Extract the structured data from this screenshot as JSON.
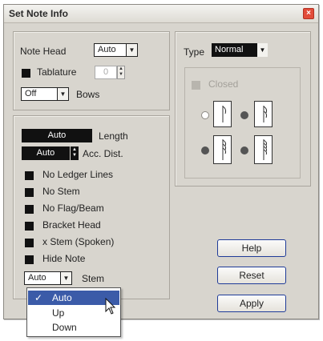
{
  "window": {
    "title": "Set Note Info",
    "close_glyph": "×"
  },
  "notehead": {
    "label": "Note Head",
    "value": "Auto",
    "tablature_label": "Tablature",
    "tablature_value": "0",
    "bows_value": "Off",
    "bows_label": "Bows"
  },
  "left": {
    "length_value": "Auto",
    "length_label": "Length",
    "acc_value": "Auto",
    "acc_label": "Acc. Dist.",
    "options": [
      "No Ledger Lines",
      "No Stem",
      "No Flag/Beam",
      "Bracket Head",
      "x Stem (Spoken)",
      "Hide Note"
    ],
    "stem_value": "Auto",
    "stem_label": "Stem"
  },
  "type": {
    "label": "Type",
    "value": "Normal",
    "closed_label": "Closed"
  },
  "buttons": {
    "help": "Help",
    "reset": "Reset",
    "apply": "Apply"
  },
  "stem_dropdown": {
    "items": [
      "Auto",
      "Up",
      "Down"
    ],
    "selected_check": "✓"
  },
  "icons": {
    "arrow": "chevron-down-icon",
    "spin": "spin-arrows-icon",
    "cursor": "mouse-pointer-icon"
  },
  "colors": {
    "dialog_bg": "#d8d5ce",
    "selection": "#3b5ba8",
    "button_border": "#1f3b99",
    "close": "#e24c3a"
  }
}
